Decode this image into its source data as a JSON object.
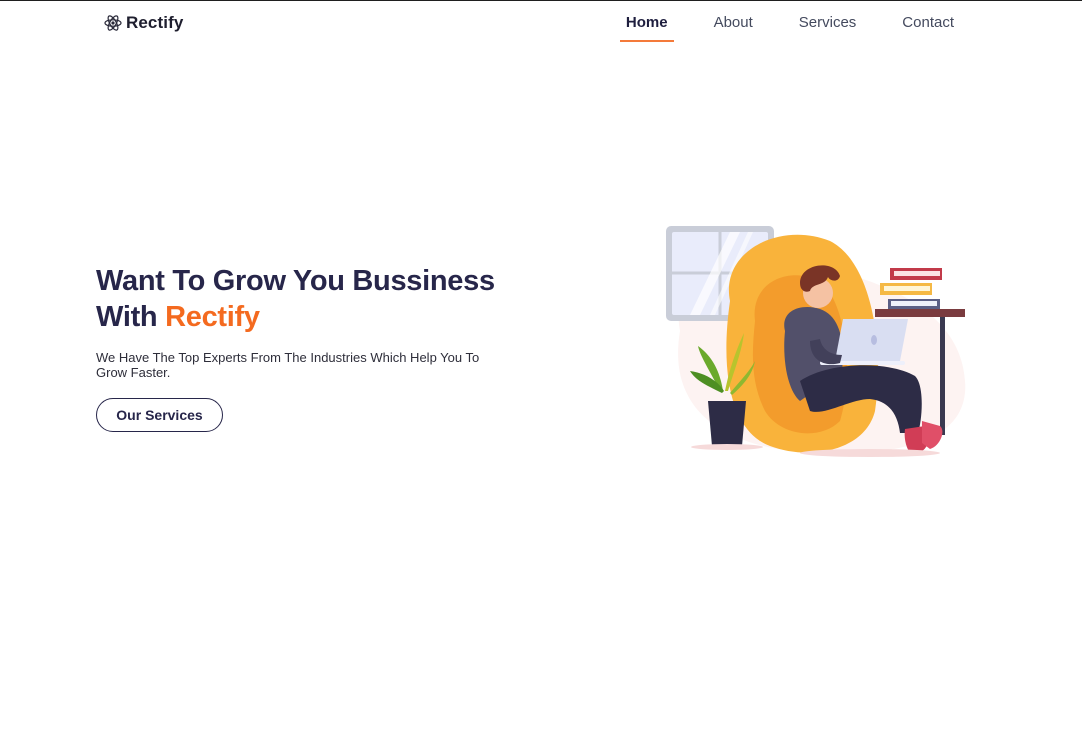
{
  "nav": {
    "brand": "Rectify",
    "brand_icon": "atom-logo-icon",
    "links": [
      "Home",
      "About",
      "Services",
      "Contact"
    ],
    "active": "Home"
  },
  "hero": {
    "title_line1": "Want To Grow You Bussiness",
    "title_line2_prefix": "With",
    "title_accent": "Rectify",
    "subtitle": "We Have The Top Experts From The Industries Which Help You To Grow Faster.",
    "cta": "Our Services"
  },
  "colors": {
    "accent": "#f46a1f",
    "primary": "#27264a",
    "chair": "#f9b33b"
  },
  "illustration": {
    "name": "person-on-beanbag-with-laptop"
  }
}
